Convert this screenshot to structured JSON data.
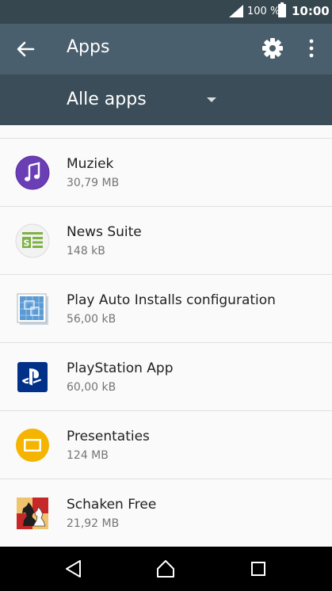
{
  "status_bar": {
    "battery_percent": "100 %",
    "time": "10:00"
  },
  "app_bar": {
    "title": "Apps"
  },
  "filter": {
    "selected": "Alle apps"
  },
  "apps": [
    {
      "name": "Muziek",
      "size": "30,79 MB",
      "icon": "music-note-icon"
    },
    {
      "name": "News Suite",
      "size": "148 kB",
      "icon": "news-suite-icon"
    },
    {
      "name": "Play Auto Installs configuration",
      "size": "56,00 kB",
      "icon": "blueprint-icon"
    },
    {
      "name": "PlayStation App",
      "size": "60,00 kB",
      "icon": "playstation-icon"
    },
    {
      "name": "Presentaties",
      "size": "124 MB",
      "icon": "slides-icon"
    },
    {
      "name": "Schaken Free",
      "size": "21,92 MB",
      "icon": "chess-knight-icon"
    }
  ],
  "colors": {
    "status_bar": "#37474f",
    "app_bar": "#4a5f6d",
    "filter_bar": "#3b4d59",
    "muziek": "#6a3fb5",
    "playstation": "#003087",
    "presentaties": "#f4b400"
  }
}
